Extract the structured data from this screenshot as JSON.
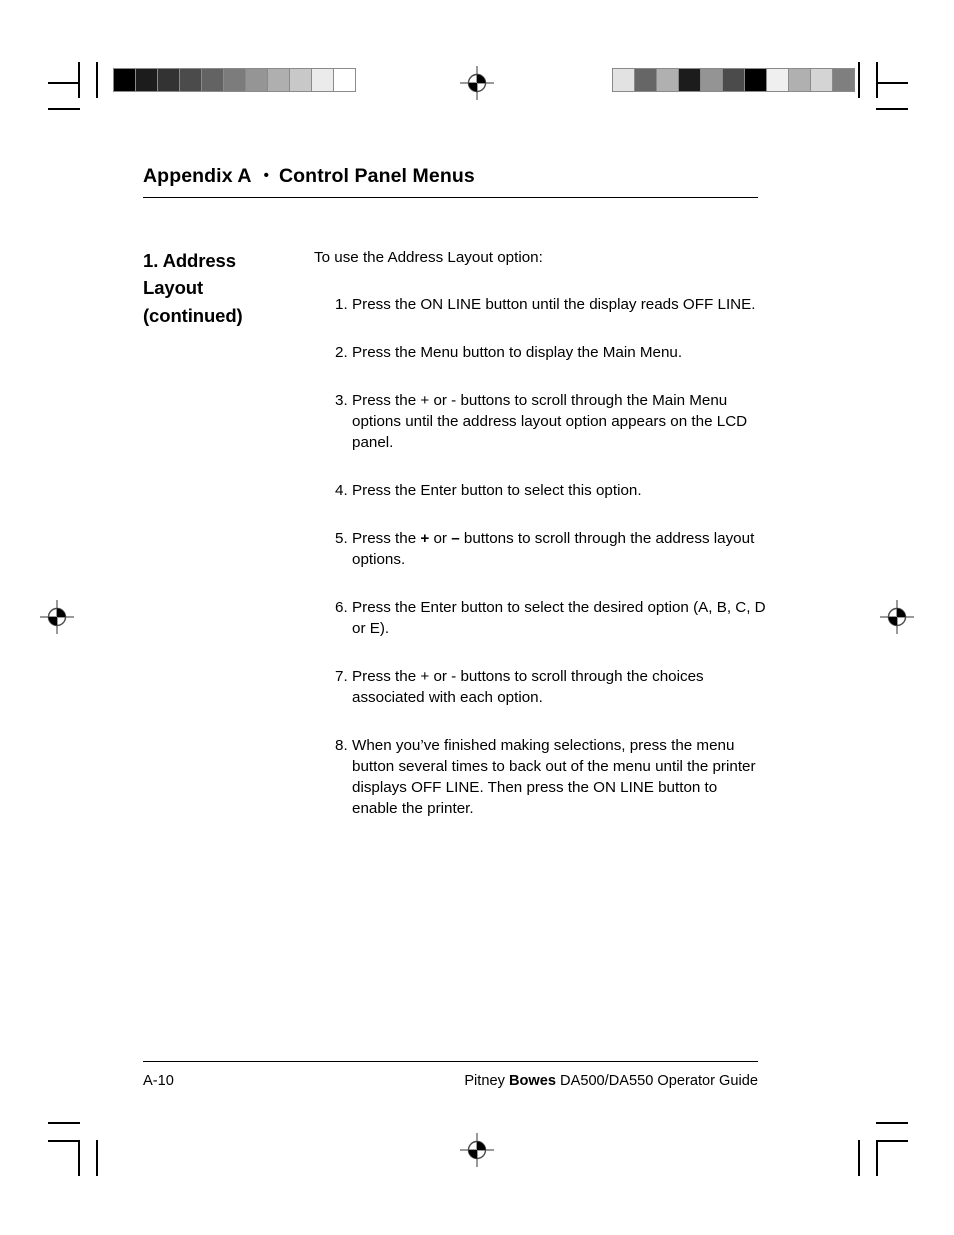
{
  "header": {
    "appendix": "Appendix A",
    "separator": "•",
    "title": "Control Panel Menus"
  },
  "sidebar": {
    "heading_line1": "1. Address",
    "heading_line2": "Layout",
    "heading_line3": "(continued)"
  },
  "content": {
    "lead_in": "To use the Address Layout option:",
    "steps": [
      {
        "num": "1.",
        "text": "Press the ON LINE button until the display reads OFF LINE."
      },
      {
        "num": "2.",
        "text": "Press the Menu button to display the Main Menu."
      },
      {
        "num": "3.",
        "text": "Press the + or - buttons to scroll through the Main Menu options until the address layout option appears on the LCD panel."
      },
      {
        "num": "4.",
        "text": "Press the Enter button to select this option."
      },
      {
        "num": "5.",
        "text_before": "Press the ",
        "key_plus": "+",
        "text_mid": " or ",
        "key_minus": "–",
        "text_after": " buttons to scroll through the address layout options."
      },
      {
        "num": "6.",
        "text": "Press the Enter button to select the desired option (A, B, C, D or E)."
      },
      {
        "num": "7.",
        "text": "Press the + or - buttons to scroll through the choices associated with each option."
      },
      {
        "num": "8.",
        "text": "When you’ve finished making selections, press the menu button several times to back out of the menu until the printer displays OFF LINE. Then press the ON LINE button to enable the printer."
      }
    ]
  },
  "footer": {
    "page_number": "A-10",
    "guide_before": "Pitney ",
    "guide_brand": "Bowes",
    "guide_after": " DA500/DA550 Operator Guide"
  },
  "calibration": {
    "left_wedge_label": "grayscale-step-wedge-ramp",
    "left_wedge_colors": [
      "#000000",
      "#1c1c1c",
      "#333333",
      "#4b4b4b",
      "#636363",
      "#7c7c7c",
      "#959595",
      "#afafaf",
      "#c8c8c8",
      "#ebebeb",
      "#ffffff"
    ],
    "right_wedge_label": "grayscale-step-wedge-scrambled",
    "right_wedge_colors": [
      "#e2e2e2",
      "#666666",
      "#b0b0b0",
      "#1c1c1c",
      "#949494",
      "#4b4b4b",
      "#000000",
      "#efefef",
      "#b0b0b0",
      "#d4d4d4",
      "#7f7f7f"
    ]
  }
}
